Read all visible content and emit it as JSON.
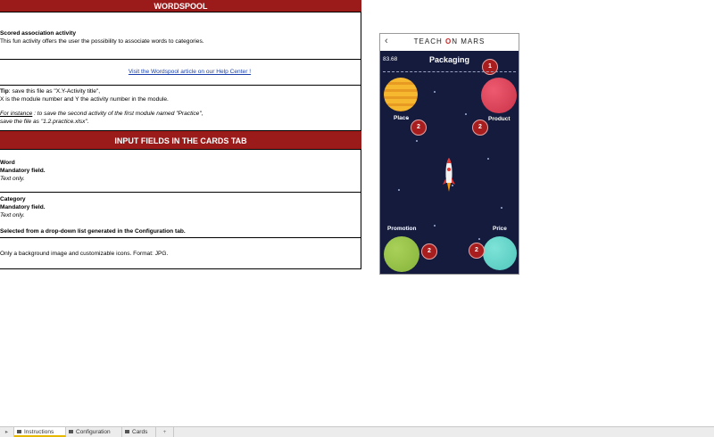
{
  "sheet": {
    "header1": "WORDSPOOL",
    "intro": {
      "heading": "Scored association activity",
      "text": "This fun activity offers the user the possibility to associate words to categories."
    },
    "link": "Visit the Wordspool article on our Help Center !",
    "tip": {
      "label": "Tip",
      "line1_rest": ": save this file as  \"X.Y-Activity title\",",
      "line2": "X is the module number and Y the activity number in the module.",
      "instance_label": "For instance",
      "line3_rest": " : to save the second activity of the first module named \"Practice\",",
      "line4": "save the file as \"1.2.practice.xlsx\"."
    },
    "header2": "INPUT FIELDS IN THE CARDS TAB",
    "word": {
      "name": "Word",
      "req": "Mandatory field.",
      "type": "Text only."
    },
    "category": {
      "name": "Category",
      "req": "Mandatory field.",
      "type": "Text only.",
      "note": "Selected from a drop-down list generated in the Configuration tab."
    },
    "background_note": "Only a background image and customizable icons. Format: JPG."
  },
  "phone": {
    "brand_left": "TEACH",
    "brand_o": "O",
    "brand_right": "N MARS",
    "back_icon": "chevron-left-icon",
    "score": "83.68",
    "title": "Packaging",
    "top_badge": "1",
    "planets": [
      {
        "label": "Place",
        "badge": "2",
        "color": "#f2a92b"
      },
      {
        "label": "Product",
        "badge": "2",
        "color": "#e0455e"
      },
      {
        "label": "Promotion",
        "badge": "2",
        "color": "#9cc44a"
      },
      {
        "label": "Price",
        "badge": "2",
        "color": "#5fd4c8"
      }
    ]
  },
  "tabs": {
    "items": [
      "Instructions",
      "Configuration",
      "Cards"
    ],
    "add": "+",
    "active": "Instructions"
  }
}
